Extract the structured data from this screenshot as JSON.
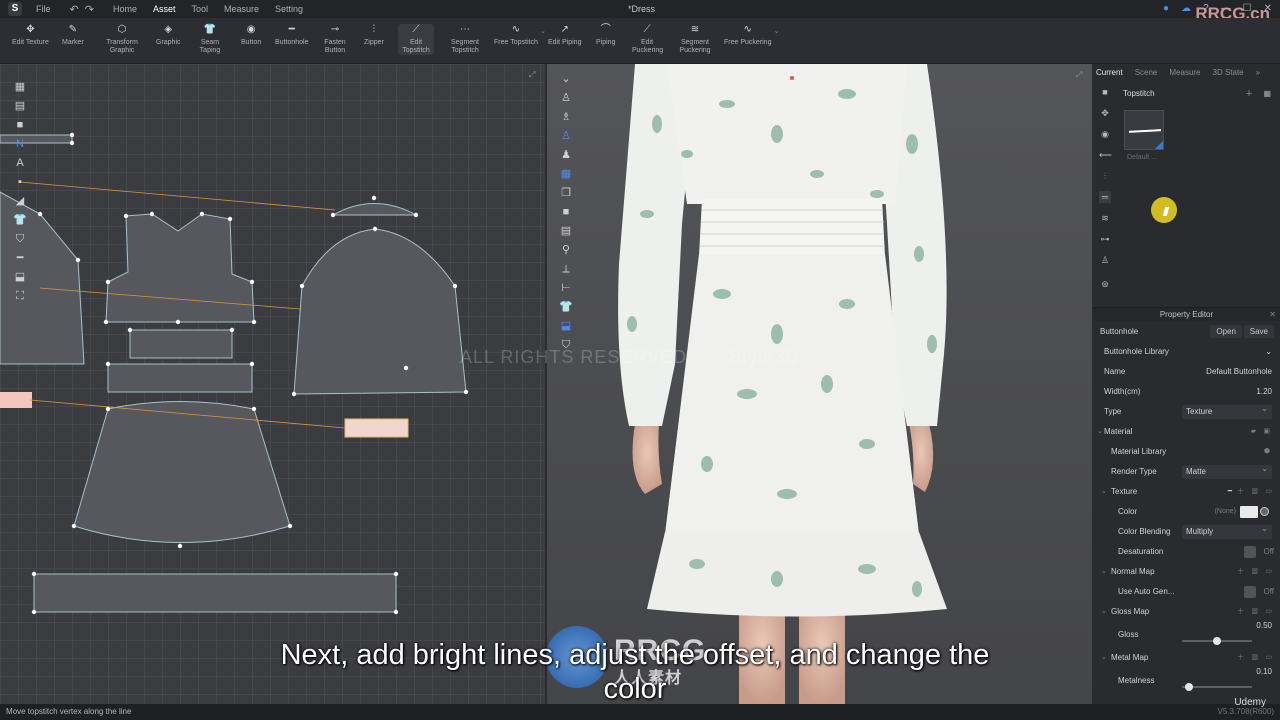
{
  "menubar": {
    "file_label": "File",
    "items": [
      "Home",
      "Asset",
      "Tool",
      "Measure",
      "Setting"
    ],
    "active_item": "Asset",
    "window_title": "*Dress"
  },
  "brand_watermark": "RRCG.cn",
  "toolbar": {
    "tools": [
      {
        "label": "Edit Texture",
        "icon": "edit-texture-icon"
      },
      {
        "label": "Marker",
        "icon": "marker-icon"
      },
      {
        "label": "Transform Graphic",
        "icon": "transform-graphic-icon"
      },
      {
        "label": "Graphic",
        "icon": "graphic-icon"
      },
      {
        "label": "Seam Taping",
        "icon": "seam-taping-icon"
      },
      {
        "label": "Button",
        "icon": "button-icon"
      },
      {
        "label": "Buttonhole",
        "icon": "buttonhole-icon"
      },
      {
        "label": "Fasten Button",
        "icon": "fasten-button-icon"
      },
      {
        "label": "Zipper",
        "icon": "zipper-icon"
      },
      {
        "label": "Edit Topstitch",
        "icon": "edit-topstitch-icon",
        "active": true
      },
      {
        "label": "Segment Topstitch",
        "icon": "segment-topstitch-icon"
      },
      {
        "label": "Free Topstitch",
        "icon": "free-topstitch-icon"
      },
      {
        "label": "Edit Piping",
        "icon": "edit-piping-icon"
      },
      {
        "label": "Piping",
        "icon": "piping-icon"
      },
      {
        "label": "Edit Puckering",
        "icon": "edit-puckering-icon"
      },
      {
        "label": "Segment Puckering",
        "icon": "segment-puckering-icon"
      },
      {
        "label": "Free Puckering",
        "icon": "free-puckering-icon"
      }
    ]
  },
  "viewport_3d": {
    "watermark": "ALL RIGHTS RESERVED.",
    "watermark_brand": "Style3D"
  },
  "right_panel": {
    "tabs": [
      "Current",
      "Scene",
      "Measure",
      "3D State"
    ],
    "active_tab": "Current",
    "library_title": "Topstitch",
    "swatch_label": "Default ..."
  },
  "property_editor": {
    "title": "Property Editor",
    "object": "Buttonhole",
    "open_label": "Open",
    "save_label": "Save",
    "library_label": "Buttonhole Library",
    "name_label": "Name",
    "name_value": "Default Buttonhole",
    "width_label": "Width(cm)",
    "width_value": "1.20",
    "type_label": "Type",
    "type_value": "Texture",
    "material_label": "Material",
    "material_library_label": "Material Library",
    "render_type_label": "Render Type",
    "render_type_value": "Matte",
    "texture_label": "Texture",
    "color_label": "Color",
    "color_none": "(None)",
    "color_blending_label": "Color Blending",
    "color_blending_value": "Multiply",
    "desaturation_label": "Desaturation",
    "desaturation_value": "Off",
    "normal_map_label": "Normal Map",
    "use_auto_gen_label": "Use Auto Gen...",
    "use_auto_gen_value": "Off",
    "gloss_map_label": "Gloss Map",
    "gloss_label": "Gloss",
    "gloss_value": "0.50",
    "gloss_level": 0.5,
    "metal_map_label": "Metal Map",
    "metalness_label": "Metalness",
    "metalness_value": "0.10",
    "metalness_level": 0.1
  },
  "status_bar": {
    "message": "Move topstitch vertex along the line",
    "version": "V5.3.708(R600)"
  },
  "subtitle": {
    "line1": "Next, add bright lines, adjust the offset, and change the",
    "line2": "color"
  },
  "overlay_brand": {
    "text": "RRCG",
    "subtext": "人人素材"
  },
  "udemy_label": "Udemy",
  "colors": {
    "accent": "#2f7fe0",
    "cursor_highlight": "#eed71e",
    "pattern_piece": "#57595e",
    "pattern_outline": "#9fb8c4",
    "topstitch_line": "#d99a3c"
  }
}
